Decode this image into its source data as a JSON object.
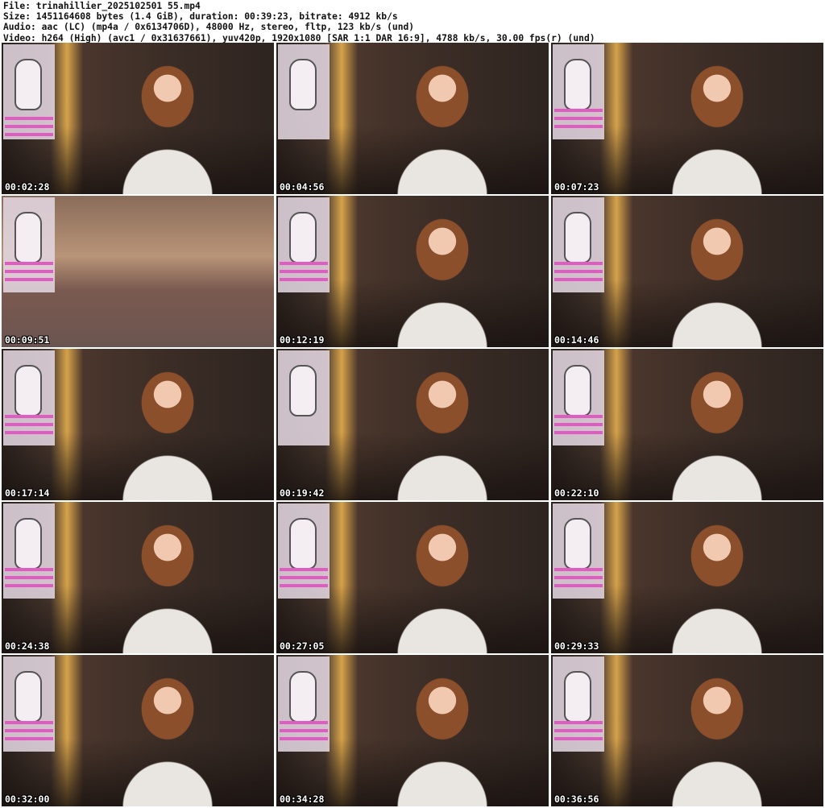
{
  "header": {
    "file": "File: trinahillier_2025102501 55.mp4",
    "size": "Size: 1451164608 bytes (1.4 GiB), duration: 00:39:23, bitrate: 4912 kb/s",
    "audio": "Audio: aac (LC) (mp4a / 0x6134706D), 48000 Hz, stereo, fltp, 123 kb/s (und)",
    "video": "Video: h264 (High) (avc1 / 0x31637661), yuv420p, 1920x1080 [SAR 1:1 DAR 16:9], 4788 kb/s, 30.00 fps(r) (und)"
  },
  "frames": [
    {
      "timestamp": "00:02:28"
    },
    {
      "timestamp": "00:04:56"
    },
    {
      "timestamp": "00:07:23"
    },
    {
      "timestamp": "00:09:51"
    },
    {
      "timestamp": "00:12:19"
    },
    {
      "timestamp": "00:14:46"
    },
    {
      "timestamp": "00:17:14"
    },
    {
      "timestamp": "00:19:42"
    },
    {
      "timestamp": "00:22:10"
    },
    {
      "timestamp": "00:24:38"
    },
    {
      "timestamp": "00:27:05"
    },
    {
      "timestamp": "00:29:33"
    },
    {
      "timestamp": "00:32:00"
    },
    {
      "timestamp": "00:34:28"
    },
    {
      "timestamp": "00:36:56"
    }
  ]
}
